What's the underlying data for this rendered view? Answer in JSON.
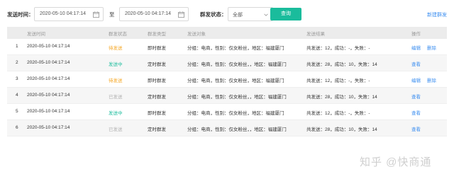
{
  "filters": {
    "send_time_label": "发送时间：",
    "start_date": "2020-05-10  04:17:14",
    "to_label": "至",
    "end_date": "2020-05-10  04:17:14",
    "status_label": "群发状态：",
    "status_value": "全部",
    "query_button": "查询",
    "new_link": "新建群发"
  },
  "table": {
    "headers": {
      "time": "发送时间",
      "status": "群发状态",
      "type": "群发类型",
      "target": "发送对象",
      "result": "发送结果",
      "op": "操作"
    },
    "rows": [
      {
        "idx": "1",
        "time": "2020-05-10  04:17:14",
        "status": "待发送",
        "type": "即时群发",
        "target": "分组：电商，性别：仅女粉丝，地区：福建厦门",
        "result": "共发送：12，成功：-，失败：-",
        "op1": "编辑",
        "op2": "删除"
      },
      {
        "idx": "2",
        "time": "2020-05-10  04:17:14",
        "status": "发送中",
        "type": "定时群发",
        "target": "分组：电商，性别：仅女粉丝，，地区：福建厦门",
        "result": "共发送：28，成功：10，失败：14",
        "op1": "查看",
        "op2": ""
      },
      {
        "idx": "3",
        "time": "2020-05-10  04:17:14",
        "status": "待发送",
        "type": "即时群发",
        "target": "分组：电商，性别：仅女粉丝，地区：福建厦门",
        "result": "共发送：12，成功：-，失败：-",
        "op1": "编辑",
        "op2": "删除"
      },
      {
        "idx": "4",
        "time": "2020-05-10  04:17:14",
        "status": "已发送",
        "type": "定时群发",
        "target": "分组：电商，性别：仅女粉丝，，地区：福建厦门",
        "result": "共发送：28，成功：10，失败：14",
        "op1": "查看",
        "op2": ""
      },
      {
        "idx": "5",
        "time": "2020-05-10  04:17:14",
        "status": "发送中",
        "type": "即时群发",
        "target": "分组：电商，性别：仅女粉丝，地区：福建厦门",
        "result": "共发送：12，成功：-，失败：-",
        "op1": "查看",
        "op2": ""
      },
      {
        "idx": "6",
        "time": "2020-05-10  04:17:14",
        "status": "已发送",
        "type": "定时群发",
        "target": "分组：电商，性别：仅女粉丝，，地区：福建厦门",
        "result": "共发送：28，成功：10，失败：14",
        "op1": "查看",
        "op2": ""
      }
    ]
  },
  "watermark": "知乎 @快商通",
  "colors": {
    "accent": "#1abc9c",
    "link": "#3d8ff0",
    "pending": "#f5a623",
    "sending": "#1abc9c",
    "sent": "#b0b0b0"
  }
}
